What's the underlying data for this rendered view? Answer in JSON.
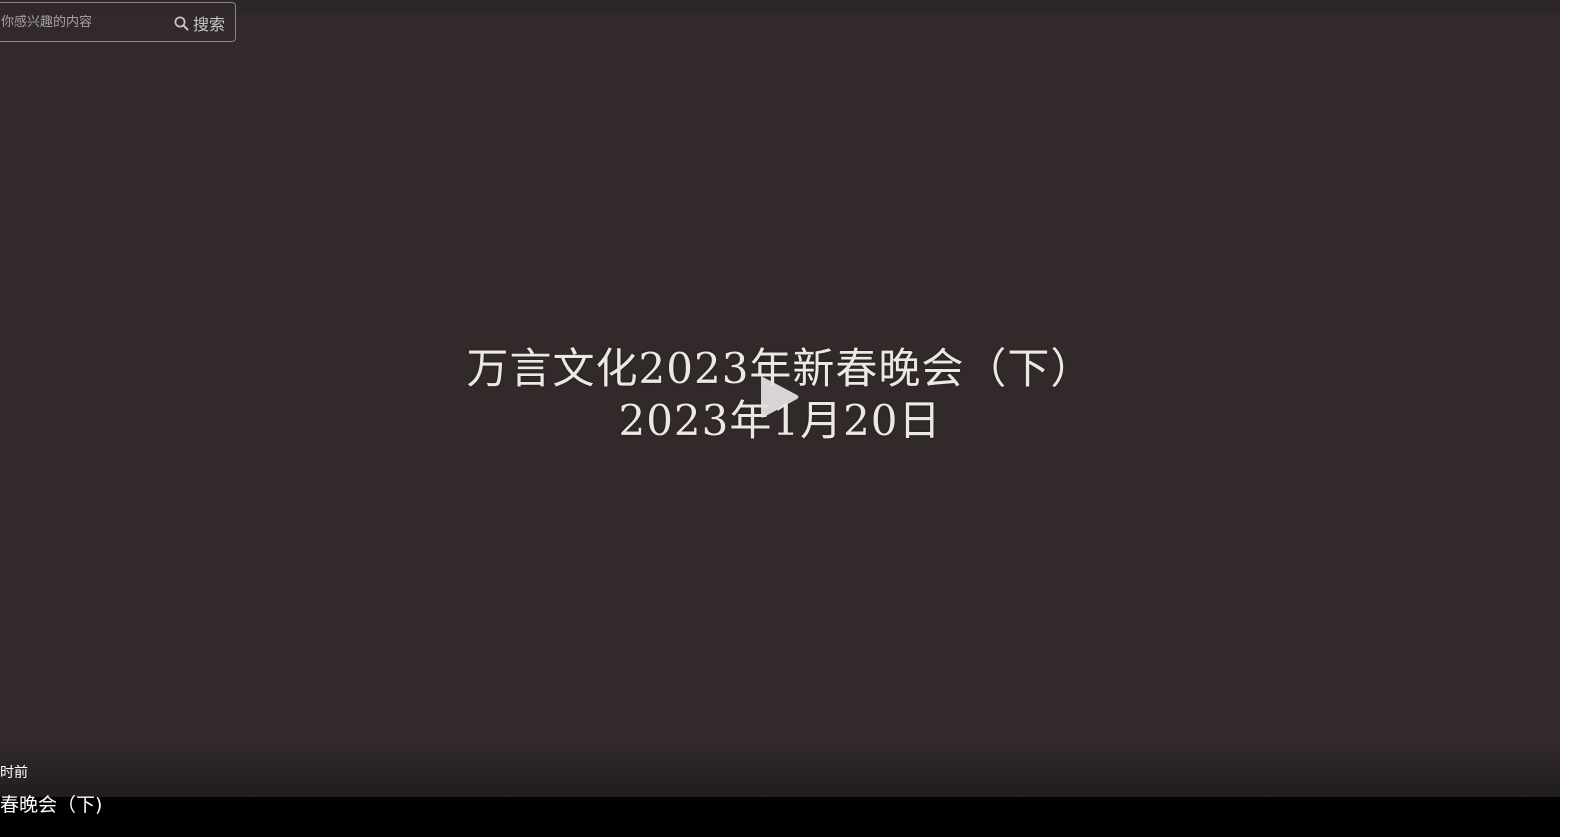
{
  "search": {
    "placeholder": "你感兴趣的内容",
    "button_label": "搜索",
    "icon": "search-icon"
  },
  "video": {
    "title_line1": "万言文化2023年新春晚会（下）",
    "title_line2": "2023年1月20日",
    "play_icon": "play-icon"
  },
  "meta": {
    "time_ago": "时前",
    "caption": "春晚会（下)"
  },
  "colors": {
    "background": "#322a2a",
    "title_text": "#ece8e2",
    "caption_bar": "#000000"
  }
}
